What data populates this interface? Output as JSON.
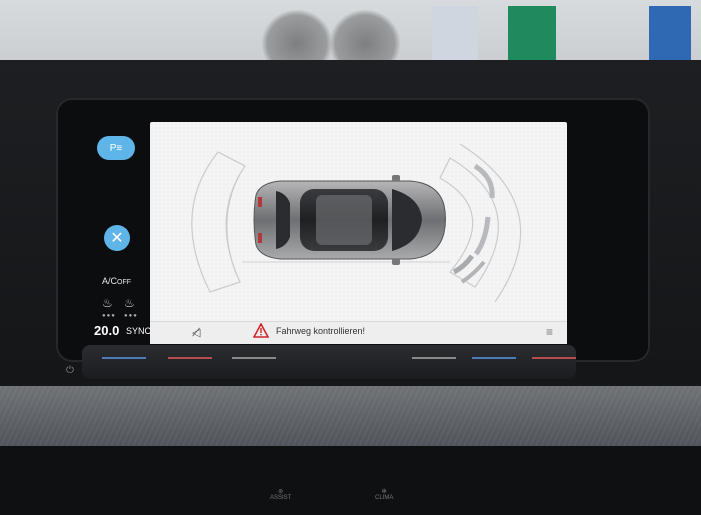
{
  "side_panel": {
    "park_button_label": "P≡",
    "ac_label": "A/C",
    "ac_state": "OFF",
    "temperature": "20.0",
    "sync_label": "SYNC"
  },
  "display": {
    "status_text": "Fahrweg kontrollieren!"
  },
  "console": {
    "assist_label": "ASSIST",
    "clima_label": "CLIMA"
  },
  "colors": {
    "accent_button": "#5fb4e8",
    "warning_red": "#d2232a",
    "display_bg": "#f4f4f5"
  }
}
